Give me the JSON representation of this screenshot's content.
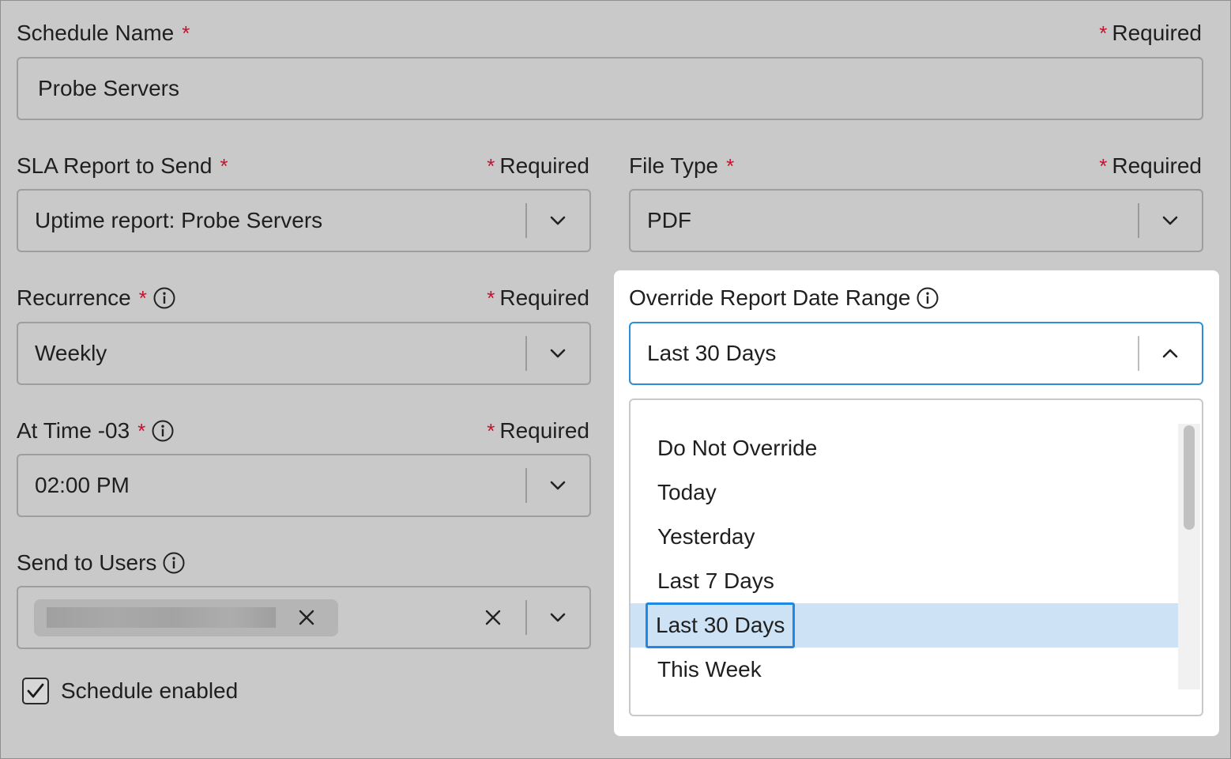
{
  "required_text": "Required",
  "required_marker": "*",
  "schedule_name": {
    "label": "Schedule Name",
    "value": "Probe Servers"
  },
  "sla_report": {
    "label": "SLA Report to Send",
    "value": "Uptime report: Probe Servers"
  },
  "file_type": {
    "label": "File Type",
    "value": "PDF"
  },
  "recurrence": {
    "label": "Recurrence",
    "value": "Weekly"
  },
  "at_time": {
    "label": "At Time -03",
    "value": "02:00 PM"
  },
  "send_to_users": {
    "label": "Send to Users",
    "chip_name_redacted": true
  },
  "schedule_enabled": {
    "label": "Schedule enabled",
    "checked": true
  },
  "override_date_range": {
    "label": "Override Report Date Range",
    "value": "Last 30 Days",
    "options": [
      "Do Not Override",
      "Today",
      "Yesterday",
      "Last 7 Days",
      "Last 30 Days",
      "This Week"
    ],
    "selected": "Last 30 Days"
  },
  "colors": {
    "required_star": "#c4122f",
    "focus_border": "#2a8fd8",
    "selected_option_bg": "#cde3f5"
  },
  "icons": [
    "info-icon",
    "chevron-down-icon",
    "chevron-up-icon",
    "close-icon",
    "check-icon"
  ]
}
